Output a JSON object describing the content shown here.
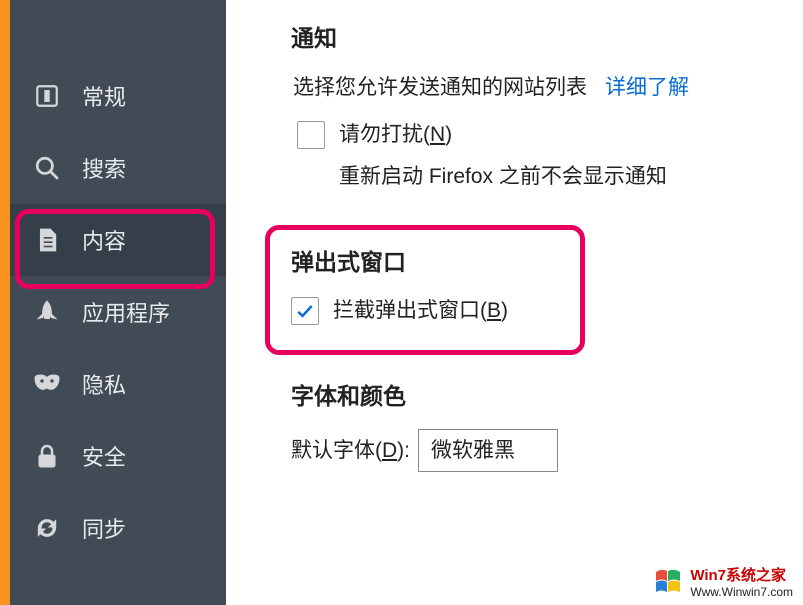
{
  "sidebar": {
    "items": [
      {
        "label": "常规"
      },
      {
        "label": "搜索"
      },
      {
        "label": "内容"
      },
      {
        "label": "应用程序"
      },
      {
        "label": "隐私"
      },
      {
        "label": "安全"
      },
      {
        "label": "同步"
      }
    ]
  },
  "sections": {
    "notifications": {
      "title": "通知",
      "desc": "选择您允许发送通知的网站列表",
      "learn_more": "详细了解",
      "do_not_disturb_prefix": "请勿打扰(",
      "do_not_disturb_key": "N",
      "do_not_disturb_suffix": ")",
      "note": "重新启动 Firefox 之前不会显示通知"
    },
    "popups": {
      "title": "弹出式窗口",
      "block_prefix": "拦截弹出式窗口(",
      "block_key": "B",
      "block_suffix": ")"
    },
    "fonts": {
      "title": "字体和颜色",
      "default_font_prefix": "默认字体(",
      "default_font_key": "D",
      "default_font_suffix": "):",
      "default_font_value": "微软雅黑"
    }
  },
  "watermark": {
    "line1": "Win7系统之家",
    "line2": "Www.Winwin7.com"
  }
}
